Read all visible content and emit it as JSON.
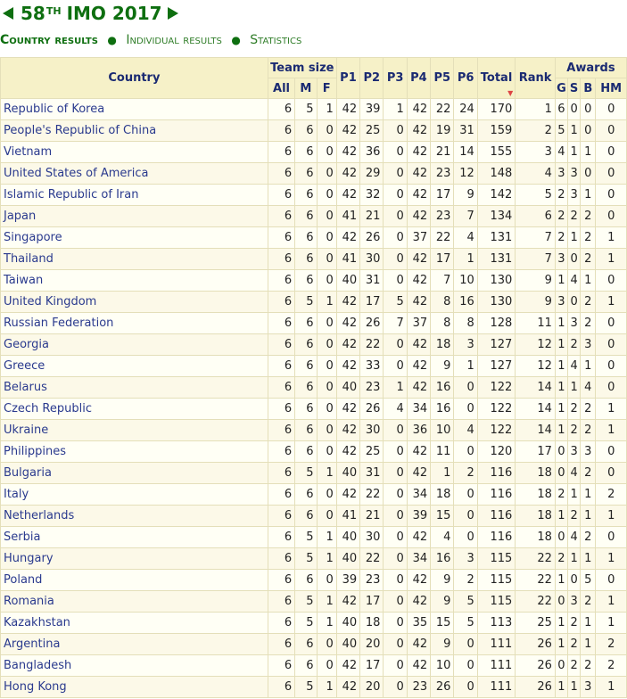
{
  "nav": {
    "title_main": "58",
    "title_sup": "TH",
    "title_rest": "IMO 2017",
    "tabs": [
      "Country results",
      "Individual results",
      "Statistics"
    ]
  },
  "table": {
    "headers": {
      "country": "Country",
      "team_size": "Team size",
      "all": "All",
      "m": "M",
      "f": "F",
      "p1": "P1",
      "p2": "P2",
      "p3": "P3",
      "p4": "P4",
      "p5": "P5",
      "p6": "P6",
      "total": "Total",
      "rank": "Rank",
      "awards": "Awards",
      "g": "G",
      "s": "S",
      "b": "B",
      "hm": "HM"
    },
    "rows": [
      [
        "Republic of Korea",
        "6",
        "5",
        "1",
        "42",
        "39",
        "1",
        "42",
        "22",
        "24",
        "170",
        "1",
        "6",
        "0",
        "0",
        "0"
      ],
      [
        "People's Republic of China",
        "6",
        "6",
        "0",
        "42",
        "25",
        "0",
        "42",
        "19",
        "31",
        "159",
        "2",
        "5",
        "1",
        "0",
        "0"
      ],
      [
        "Vietnam",
        "6",
        "6",
        "0",
        "42",
        "36",
        "0",
        "42",
        "21",
        "14",
        "155",
        "3",
        "4",
        "1",
        "1",
        "0"
      ],
      [
        "United States of America",
        "6",
        "6",
        "0",
        "42",
        "29",
        "0",
        "42",
        "23",
        "12",
        "148",
        "4",
        "3",
        "3",
        "0",
        "0"
      ],
      [
        "Islamic Republic of Iran",
        "6",
        "6",
        "0",
        "42",
        "32",
        "0",
        "42",
        "17",
        "9",
        "142",
        "5",
        "2",
        "3",
        "1",
        "0"
      ],
      [
        "Japan",
        "6",
        "6",
        "0",
        "41",
        "21",
        "0",
        "42",
        "23",
        "7",
        "134",
        "6",
        "2",
        "2",
        "2",
        "0"
      ],
      [
        "Singapore",
        "6",
        "6",
        "0",
        "42",
        "26",
        "0",
        "37",
        "22",
        "4",
        "131",
        "7",
        "2",
        "1",
        "2",
        "1"
      ],
      [
        "Thailand",
        "6",
        "6",
        "0",
        "41",
        "30",
        "0",
        "42",
        "17",
        "1",
        "131",
        "7",
        "3",
        "0",
        "2",
        "1"
      ],
      [
        "Taiwan",
        "6",
        "6",
        "0",
        "40",
        "31",
        "0",
        "42",
        "7",
        "10",
        "130",
        "9",
        "1",
        "4",
        "1",
        "0"
      ],
      [
        "United Kingdom",
        "6",
        "5",
        "1",
        "42",
        "17",
        "5",
        "42",
        "8",
        "16",
        "130",
        "9",
        "3",
        "0",
        "2",
        "1"
      ],
      [
        "Russian Federation",
        "6",
        "6",
        "0",
        "42",
        "26",
        "7",
        "37",
        "8",
        "8",
        "128",
        "11",
        "1",
        "3",
        "2",
        "0"
      ],
      [
        "Georgia",
        "6",
        "6",
        "0",
        "42",
        "22",
        "0",
        "42",
        "18",
        "3",
        "127",
        "12",
        "1",
        "2",
        "3",
        "0"
      ],
      [
        "Greece",
        "6",
        "6",
        "0",
        "42",
        "33",
        "0",
        "42",
        "9",
        "1",
        "127",
        "12",
        "1",
        "4",
        "1",
        "0"
      ],
      [
        "Belarus",
        "6",
        "6",
        "0",
        "40",
        "23",
        "1",
        "42",
        "16",
        "0",
        "122",
        "14",
        "1",
        "1",
        "4",
        "0"
      ],
      [
        "Czech Republic",
        "6",
        "6",
        "0",
        "42",
        "26",
        "4",
        "34",
        "16",
        "0",
        "122",
        "14",
        "1",
        "2",
        "2",
        "1"
      ],
      [
        "Ukraine",
        "6",
        "6",
        "0",
        "42",
        "30",
        "0",
        "36",
        "10",
        "4",
        "122",
        "14",
        "1",
        "2",
        "2",
        "1"
      ],
      [
        "Philippines",
        "6",
        "6",
        "0",
        "42",
        "25",
        "0",
        "42",
        "11",
        "0",
        "120",
        "17",
        "0",
        "3",
        "3",
        "0"
      ],
      [
        "Bulgaria",
        "6",
        "5",
        "1",
        "40",
        "31",
        "0",
        "42",
        "1",
        "2",
        "116",
        "18",
        "0",
        "4",
        "2",
        "0"
      ],
      [
        "Italy",
        "6",
        "6",
        "0",
        "42",
        "22",
        "0",
        "34",
        "18",
        "0",
        "116",
        "18",
        "2",
        "1",
        "1",
        "2"
      ],
      [
        "Netherlands",
        "6",
        "6",
        "0",
        "41",
        "21",
        "0",
        "39",
        "15",
        "0",
        "116",
        "18",
        "1",
        "2",
        "1",
        "1"
      ],
      [
        "Serbia",
        "6",
        "5",
        "1",
        "40",
        "30",
        "0",
        "42",
        "4",
        "0",
        "116",
        "18",
        "0",
        "4",
        "2",
        "0"
      ],
      [
        "Hungary",
        "6",
        "5",
        "1",
        "40",
        "22",
        "0",
        "34",
        "16",
        "3",
        "115",
        "22",
        "2",
        "1",
        "1",
        "1"
      ],
      [
        "Poland",
        "6",
        "6",
        "0",
        "39",
        "23",
        "0",
        "42",
        "9",
        "2",
        "115",
        "22",
        "1",
        "0",
        "5",
        "0"
      ],
      [
        "Romania",
        "6",
        "5",
        "1",
        "42",
        "17",
        "0",
        "42",
        "9",
        "5",
        "115",
        "22",
        "0",
        "3",
        "2",
        "1"
      ],
      [
        "Kazakhstan",
        "6",
        "5",
        "1",
        "40",
        "18",
        "0",
        "35",
        "15",
        "5",
        "113",
        "25",
        "1",
        "2",
        "1",
        "1"
      ],
      [
        "Argentina",
        "6",
        "6",
        "0",
        "40",
        "20",
        "0",
        "42",
        "9",
        "0",
        "111",
        "26",
        "1",
        "2",
        "1",
        "2"
      ],
      [
        "Bangladesh",
        "6",
        "6",
        "0",
        "42",
        "17",
        "0",
        "42",
        "10",
        "0",
        "111",
        "26",
        "0",
        "2",
        "2",
        "2"
      ],
      [
        "Hong Kong",
        "6",
        "5",
        "1",
        "42",
        "20",
        "0",
        "23",
        "26",
        "0",
        "111",
        "26",
        "1",
        "1",
        "3",
        "1"
      ]
    ]
  },
  "colors": {
    "brand_green": "#0e6f10",
    "header_bg": "#f6f1c8",
    "link_blue": "#2a3a8e"
  }
}
